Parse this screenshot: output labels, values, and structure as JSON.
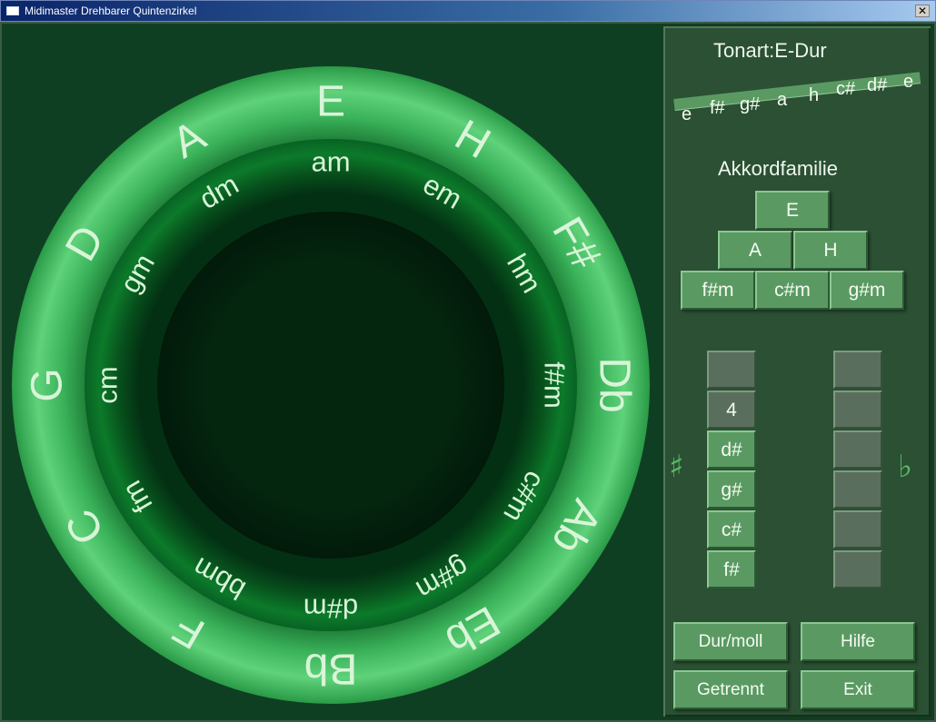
{
  "window": {
    "title": "Midimaster Drehbarer Quintenzirkel",
    "close_glyph": "✕"
  },
  "circle": {
    "major": [
      "E",
      "H",
      "F#",
      "Db",
      "Ab",
      "Eb",
      "Bb",
      "F",
      "C",
      "G",
      "D",
      "A"
    ],
    "minor": [
      "am",
      "em",
      "hm",
      "f#m",
      "c#m",
      "g#m",
      "d#m",
      "bbm",
      "fm",
      "cm",
      "gm",
      "dm"
    ]
  },
  "panel": {
    "tonart": "Tonart:E-Dur",
    "scale_notes": [
      "e",
      "f#",
      "g#",
      "a",
      "h",
      "c#",
      "d#",
      "e"
    ],
    "akkordfamilie_label": "Akkordfamilie",
    "chords": {
      "top": "E",
      "middle": [
        "A",
        "H"
      ],
      "bottom": [
        "f#m",
        "c#m",
        "g#m"
      ]
    },
    "sharp_symbol": "♯",
    "flat_symbol": "♭",
    "sharps_column": [
      "",
      "4",
      "d#",
      "g#",
      "c#",
      "f#"
    ],
    "flats_column": [
      "",
      "",
      "",
      "",
      "",
      ""
    ],
    "buttons": {
      "durmoll": "Dur/moll",
      "hilfe": "Hilfe",
      "getrennt": "Getrennt",
      "exit": "Exit"
    }
  },
  "colors": {
    "background": "#0f3f22",
    "outer_ring": "#2e9e4a",
    "inner_ring": "#0b6a25",
    "center": "#04240f",
    "text": "#d8f5d8",
    "button": "#5a9a62"
  }
}
